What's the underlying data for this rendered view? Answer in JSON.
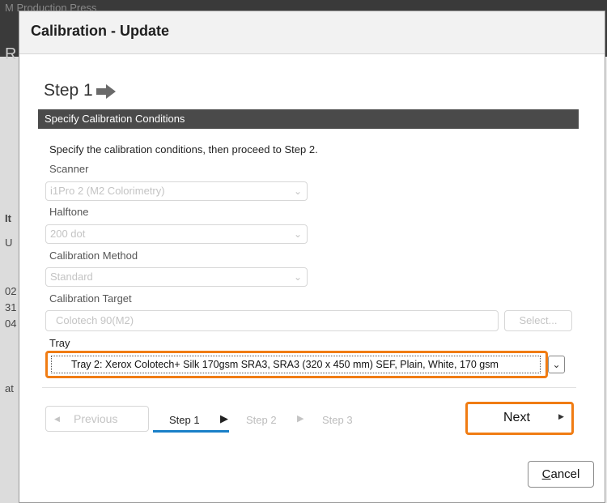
{
  "background": {
    "title_fragment": "M Production Press",
    "side_chars": [
      "R",
      "It",
      "U",
      "02",
      "31",
      "04",
      "at"
    ]
  },
  "dialog": {
    "title": "Calibration - Update"
  },
  "step_heading": "Step 1",
  "section_title": "Specify Calibration Conditions",
  "intro": "Specify the calibration conditions, then proceed to Step 2.",
  "fields": {
    "scanner": {
      "label": "Scanner",
      "value": "i1Pro 2 (M2 Colorimetry)"
    },
    "halftone": {
      "label": "Halftone",
      "value": "200 dot"
    },
    "method": {
      "label": "Calibration Method",
      "value": "Standard"
    },
    "target": {
      "label": "Calibration Target",
      "value": "Colotech 90(M2)",
      "button": "Select..."
    },
    "tray": {
      "label": "Tray",
      "value": "Tray 2: Xerox Colotech+ Silk 170gsm SRA3, SRA3 (320 x 450 mm) SEF, Plain, White, 170 gsm"
    }
  },
  "nav": {
    "previous": "Previous",
    "steps": [
      "Step 1",
      "Step 2",
      "Step 3"
    ],
    "next": "Next",
    "cancel_c": "C",
    "cancel_rest": "ancel"
  },
  "colors": {
    "highlight": "#f07c13",
    "active_step": "#1a80c8",
    "section_bar": "#4a4a4a"
  }
}
